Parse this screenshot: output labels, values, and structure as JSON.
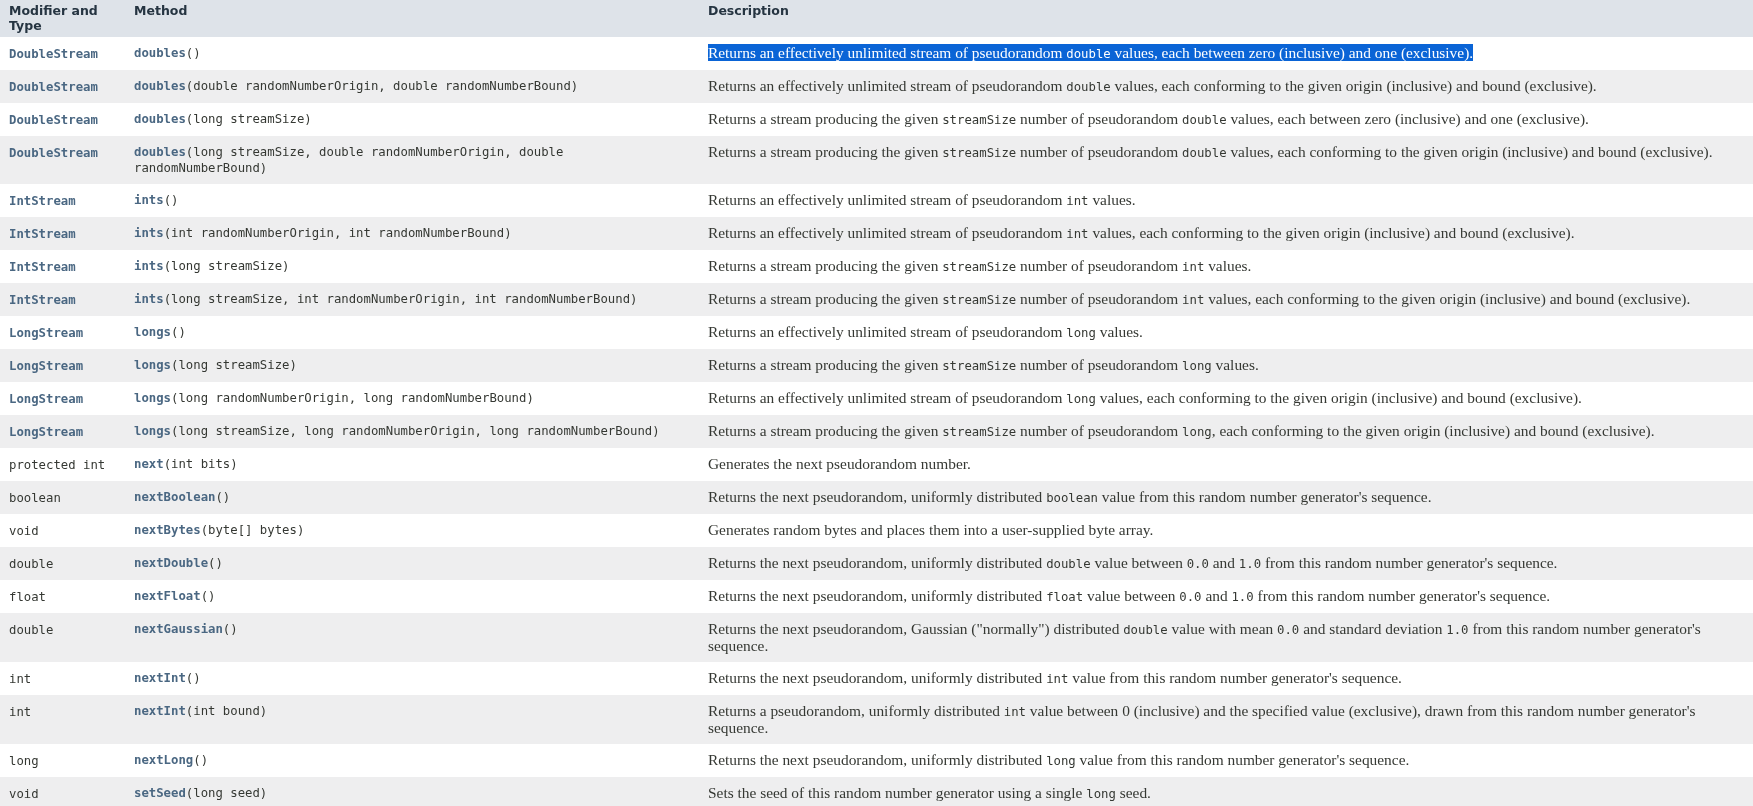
{
  "table": {
    "columns": [
      "Modifier and Type",
      "Method",
      "Description"
    ],
    "rows": [
      {
        "type": {
          "text": "DoubleStream",
          "link": true
        },
        "method": {
          "name": "doubles",
          "params": "()"
        },
        "highlighted": true,
        "description": [
          {
            "t": "Returns an effectively unlimited stream of pseudorandom ",
            "code": false
          },
          {
            "t": "double",
            "code": true
          },
          {
            "t": " values, each between zero (inclusive) and one (exclusive).",
            "code": false
          }
        ]
      },
      {
        "type": {
          "text": "DoubleStream",
          "link": true
        },
        "method": {
          "name": "doubles",
          "params": "(double randomNumberOrigin, double randomNumberBound)"
        },
        "highlighted": false,
        "description": [
          {
            "t": "Returns an effectively unlimited stream of pseudorandom ",
            "code": false
          },
          {
            "t": "double",
            "code": true
          },
          {
            "t": " values, each conforming to the given origin (inclusive) and bound (exclusive).",
            "code": false
          }
        ]
      },
      {
        "type": {
          "text": "DoubleStream",
          "link": true
        },
        "method": {
          "name": "doubles",
          "params": "(long streamSize)"
        },
        "highlighted": false,
        "description": [
          {
            "t": "Returns a stream producing the given ",
            "code": false
          },
          {
            "t": "streamSize",
            "code": true
          },
          {
            "t": " number of pseudorandom ",
            "code": false
          },
          {
            "t": "double",
            "code": true
          },
          {
            "t": " values, each between zero (inclusive) and one (exclusive).",
            "code": false
          }
        ]
      },
      {
        "type": {
          "text": "DoubleStream",
          "link": true
        },
        "method": {
          "name": "doubles",
          "params": "(long streamSize, double randomNumberOrigin, double randomNumberBound)"
        },
        "highlighted": false,
        "description": [
          {
            "t": "Returns a stream producing the given ",
            "code": false
          },
          {
            "t": "streamSize",
            "code": true
          },
          {
            "t": " number of pseudorandom ",
            "code": false
          },
          {
            "t": "double",
            "code": true
          },
          {
            "t": " values, each conforming to the given origin (inclusive) and bound (exclusive).",
            "code": false
          }
        ]
      },
      {
        "type": {
          "text": "IntStream",
          "link": true
        },
        "method": {
          "name": "ints",
          "params": "()"
        },
        "highlighted": false,
        "description": [
          {
            "t": "Returns an effectively unlimited stream of pseudorandom ",
            "code": false
          },
          {
            "t": "int",
            "code": true
          },
          {
            "t": " values.",
            "code": false
          }
        ]
      },
      {
        "type": {
          "text": "IntStream",
          "link": true
        },
        "method": {
          "name": "ints",
          "params": "(int randomNumberOrigin, int randomNumberBound)"
        },
        "highlighted": false,
        "description": [
          {
            "t": "Returns an effectively unlimited stream of pseudorandom ",
            "code": false
          },
          {
            "t": "int",
            "code": true
          },
          {
            "t": " values, each conforming to the given origin (inclusive) and bound (exclusive).",
            "code": false
          }
        ]
      },
      {
        "type": {
          "text": "IntStream",
          "link": true
        },
        "method": {
          "name": "ints",
          "params": "(long streamSize)"
        },
        "highlighted": false,
        "description": [
          {
            "t": "Returns a stream producing the given ",
            "code": false
          },
          {
            "t": "streamSize",
            "code": true
          },
          {
            "t": " number of pseudorandom ",
            "code": false
          },
          {
            "t": "int",
            "code": true
          },
          {
            "t": " values.",
            "code": false
          }
        ]
      },
      {
        "type": {
          "text": "IntStream",
          "link": true
        },
        "method": {
          "name": "ints",
          "params": "(long streamSize, int randomNumberOrigin, int randomNumberBound)"
        },
        "highlighted": false,
        "description": [
          {
            "t": "Returns a stream producing the given ",
            "code": false
          },
          {
            "t": "streamSize",
            "code": true
          },
          {
            "t": " number of pseudorandom ",
            "code": false
          },
          {
            "t": "int",
            "code": true
          },
          {
            "t": " values, each conforming to the given origin (inclusive) and bound (exclusive).",
            "code": false
          }
        ]
      },
      {
        "type": {
          "text": "LongStream",
          "link": true
        },
        "method": {
          "name": "longs",
          "params": "()"
        },
        "highlighted": false,
        "description": [
          {
            "t": "Returns an effectively unlimited stream of pseudorandom ",
            "code": false
          },
          {
            "t": "long",
            "code": true
          },
          {
            "t": " values.",
            "code": false
          }
        ]
      },
      {
        "type": {
          "text": "LongStream",
          "link": true
        },
        "method": {
          "name": "longs",
          "params": "(long streamSize)"
        },
        "highlighted": false,
        "description": [
          {
            "t": "Returns a stream producing the given ",
            "code": false
          },
          {
            "t": "streamSize",
            "code": true
          },
          {
            "t": " number of pseudorandom ",
            "code": false
          },
          {
            "t": "long",
            "code": true
          },
          {
            "t": " values.",
            "code": false
          }
        ]
      },
      {
        "type": {
          "text": "LongStream",
          "link": true
        },
        "method": {
          "name": "longs",
          "params": "(long randomNumberOrigin, long randomNumberBound)"
        },
        "highlighted": false,
        "description": [
          {
            "t": "Returns an effectively unlimited stream of pseudorandom ",
            "code": false
          },
          {
            "t": "long",
            "code": true
          },
          {
            "t": " values, each conforming to the given origin (inclusive) and bound (exclusive).",
            "code": false
          }
        ]
      },
      {
        "type": {
          "text": "LongStream",
          "link": true
        },
        "method": {
          "name": "longs",
          "params": "(long streamSize, long randomNumberOrigin, long randomNumberBound)"
        },
        "highlighted": false,
        "description": [
          {
            "t": "Returns a stream producing the given ",
            "code": false
          },
          {
            "t": "streamSize",
            "code": true
          },
          {
            "t": " number of pseudorandom ",
            "code": false
          },
          {
            "t": "long",
            "code": true
          },
          {
            "t": ", each conforming to the given origin (inclusive) and bound (exclusive).",
            "code": false
          }
        ]
      },
      {
        "type": {
          "text": "protected int",
          "link": false
        },
        "method": {
          "name": "next",
          "params": "(int bits)"
        },
        "highlighted": false,
        "description": [
          {
            "t": "Generates the next pseudorandom number.",
            "code": false
          }
        ]
      },
      {
        "type": {
          "text": "boolean",
          "link": false
        },
        "method": {
          "name": "nextBoolean",
          "params": "()"
        },
        "highlighted": false,
        "description": [
          {
            "t": "Returns the next pseudorandom, uniformly distributed ",
            "code": false
          },
          {
            "t": "boolean",
            "code": true
          },
          {
            "t": " value from this random number generator's sequence.",
            "code": false
          }
        ]
      },
      {
        "type": {
          "text": "void",
          "link": false
        },
        "method": {
          "name": "nextBytes",
          "params": "(byte[] bytes)"
        },
        "highlighted": false,
        "description": [
          {
            "t": "Generates random bytes and places them into a user-supplied byte array.",
            "code": false
          }
        ]
      },
      {
        "type": {
          "text": "double",
          "link": false
        },
        "method": {
          "name": "nextDouble",
          "params": "()"
        },
        "highlighted": false,
        "description": [
          {
            "t": "Returns the next pseudorandom, uniformly distributed ",
            "code": false
          },
          {
            "t": "double",
            "code": true
          },
          {
            "t": " value between ",
            "code": false
          },
          {
            "t": "0.0",
            "code": true
          },
          {
            "t": " and ",
            "code": false
          },
          {
            "t": "1.0",
            "code": true
          },
          {
            "t": " from this random number generator's sequence.",
            "code": false
          }
        ]
      },
      {
        "type": {
          "text": "float",
          "link": false
        },
        "method": {
          "name": "nextFloat",
          "params": "()"
        },
        "highlighted": false,
        "description": [
          {
            "t": "Returns the next pseudorandom, uniformly distributed ",
            "code": false
          },
          {
            "t": "float",
            "code": true
          },
          {
            "t": " value between ",
            "code": false
          },
          {
            "t": "0.0",
            "code": true
          },
          {
            "t": " and ",
            "code": false
          },
          {
            "t": "1.0",
            "code": true
          },
          {
            "t": " from this random number generator's sequence.",
            "code": false
          }
        ]
      },
      {
        "type": {
          "text": "double",
          "link": false
        },
        "method": {
          "name": "nextGaussian",
          "params": "()"
        },
        "highlighted": false,
        "description": [
          {
            "t": "Returns the next pseudorandom, Gaussian (\"normally\") distributed ",
            "code": false
          },
          {
            "t": "double",
            "code": true
          },
          {
            "t": " value with mean ",
            "code": false
          },
          {
            "t": "0.0",
            "code": true
          },
          {
            "t": " and standard deviation ",
            "code": false
          },
          {
            "t": "1.0",
            "code": true
          },
          {
            "t": " from this random number generator's sequence.",
            "code": false
          }
        ]
      },
      {
        "type": {
          "text": "int",
          "link": false
        },
        "method": {
          "name": "nextInt",
          "params": "()"
        },
        "highlighted": false,
        "description": [
          {
            "t": "Returns the next pseudorandom, uniformly distributed ",
            "code": false
          },
          {
            "t": "int",
            "code": true
          },
          {
            "t": " value from this random number generator's sequence.",
            "code": false
          }
        ]
      },
      {
        "type": {
          "text": "int",
          "link": false
        },
        "method": {
          "name": "nextInt",
          "params": "(int bound)"
        },
        "highlighted": false,
        "description": [
          {
            "t": "Returns a pseudorandom, uniformly distributed ",
            "code": false
          },
          {
            "t": "int",
            "code": true
          },
          {
            "t": " value between 0 (inclusive) and the specified value (exclusive), drawn from this random number generator's sequence.",
            "code": false
          }
        ]
      },
      {
        "type": {
          "text": "long",
          "link": false
        },
        "method": {
          "name": "nextLong",
          "params": "()"
        },
        "highlighted": false,
        "description": [
          {
            "t": "Returns the next pseudorandom, uniformly distributed ",
            "code": false
          },
          {
            "t": "long",
            "code": true
          },
          {
            "t": " value from this random number generator's sequence.",
            "code": false
          }
        ]
      },
      {
        "type": {
          "text": "void",
          "link": false
        },
        "method": {
          "name": "setSeed",
          "params": "(long seed)"
        },
        "highlighted": false,
        "description": [
          {
            "t": "Sets the seed of this random number generator using a single ",
            "code": false
          },
          {
            "t": "long",
            "code": true
          },
          {
            "t": " seed.",
            "code": false
          }
        ]
      }
    ]
  }
}
